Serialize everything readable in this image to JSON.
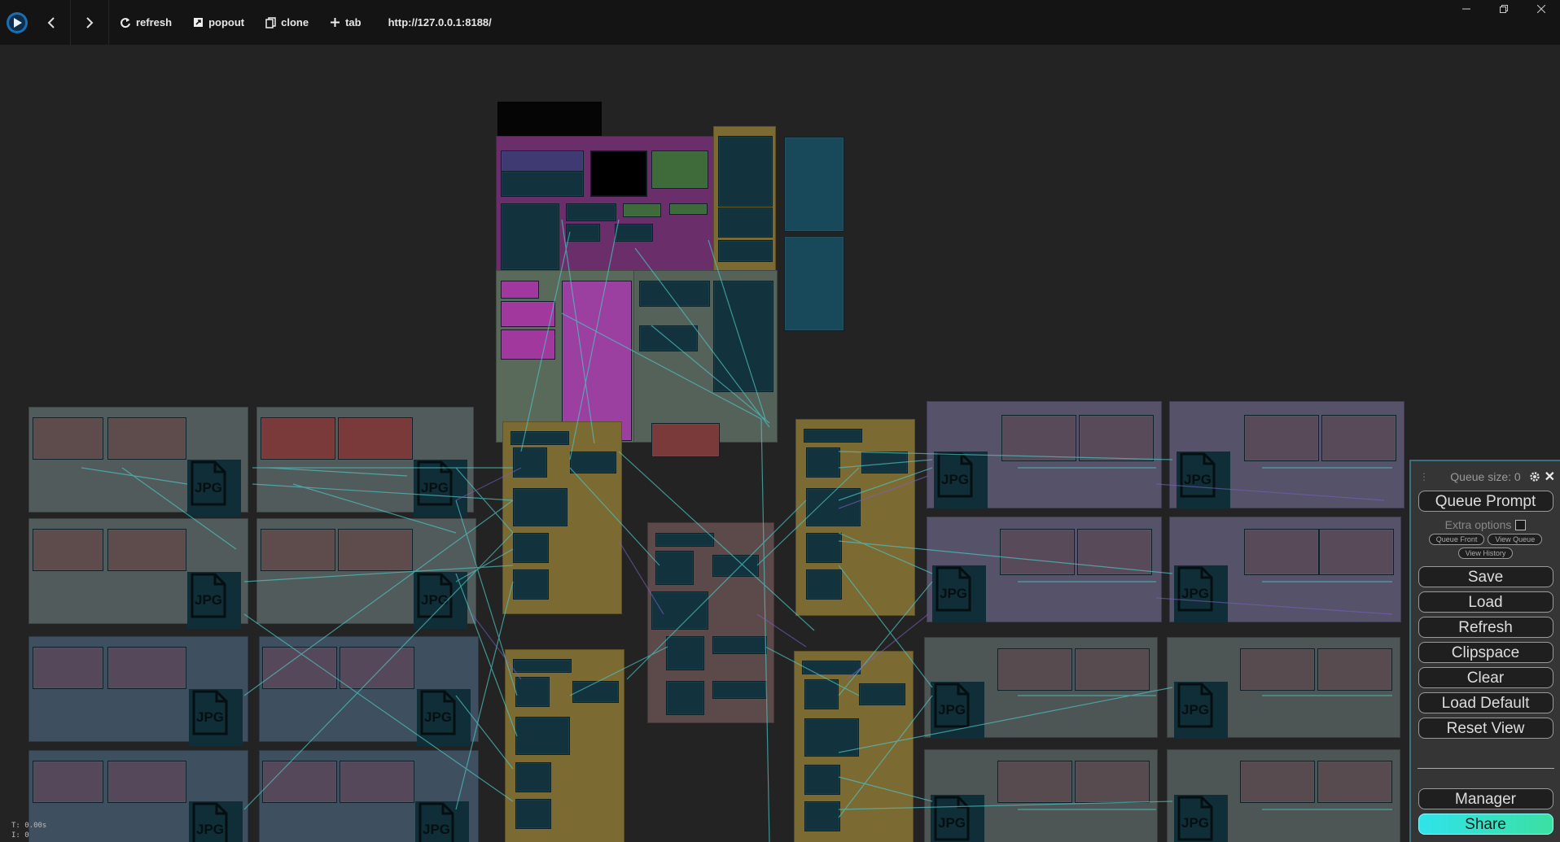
{
  "toolbar": {
    "refresh": "refresh",
    "popout": "popout",
    "clone": "clone",
    "tab": "tab",
    "url": "http://127.0.0.1:8188/"
  },
  "canvas": {
    "jpg_label": "JPG",
    "stats": {
      "t": "T: 0.00s",
      "i": "I: 0"
    }
  },
  "menu": {
    "queue_size": "Queue size: 0",
    "queue_prompt": "Queue Prompt",
    "extra_options": "Extra options",
    "queue_front": "Queue Front",
    "view_queue": "View Queue",
    "view_history": "View History",
    "save": "Save",
    "load": "Load",
    "refresh": "Refresh",
    "clipspace": "Clipspace",
    "clear": "Clear",
    "load_default": "Load Default",
    "reset_view": "Reset View",
    "manager": "Manager",
    "share": "Share"
  },
  "colors": {
    "accent": "#3a6f7f",
    "node": "#12323d",
    "group_olive": "#7c6a33",
    "group_purple": "#6a2f6a",
    "group_grey": "#515b5b",
    "group_blue": "#3e4f5f",
    "share_gradient": "#2fe3ea"
  }
}
